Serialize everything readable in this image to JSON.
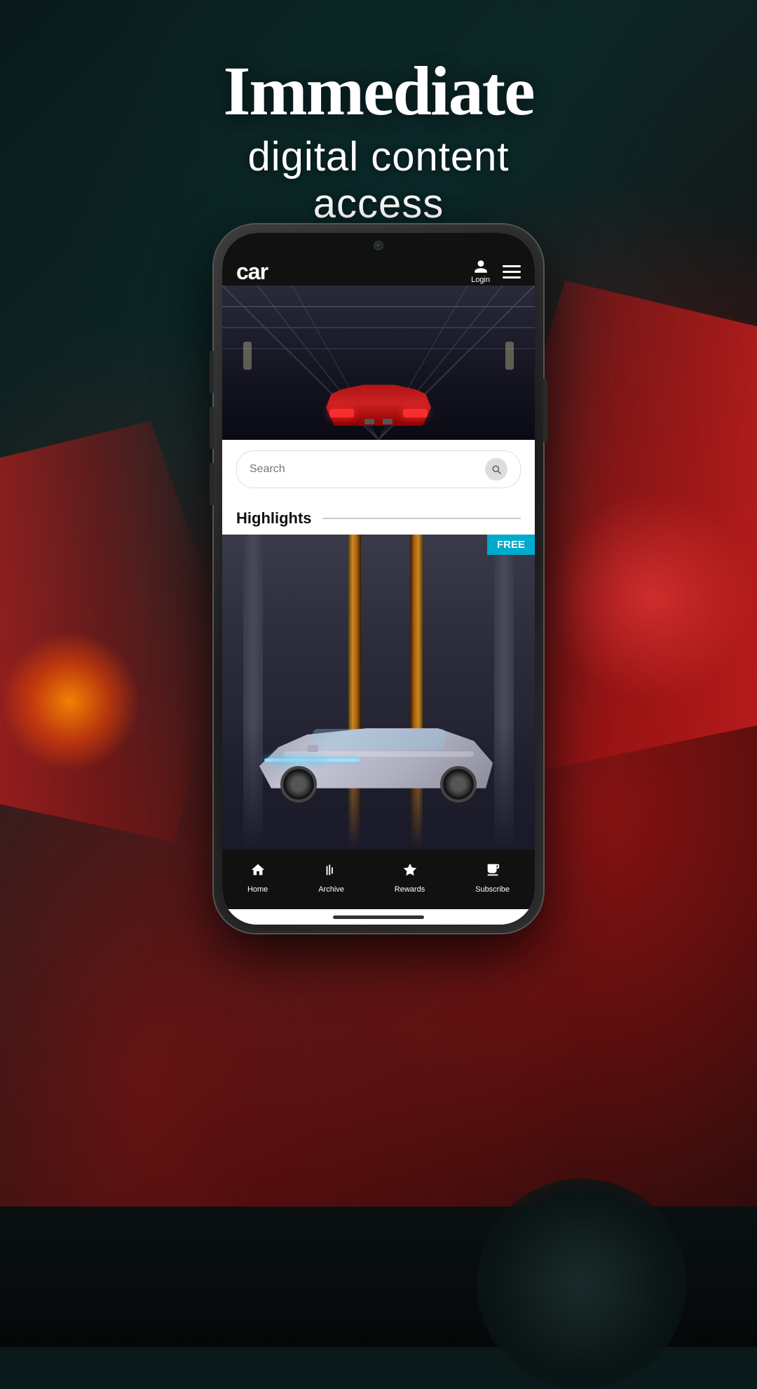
{
  "background": {
    "color": "#0a1a1a"
  },
  "header": {
    "line1": "Immediate",
    "line2": "digital content",
    "line3": "access"
  },
  "phone": {
    "app": {
      "brand_logo": "car",
      "nav_login": "Login",
      "nav_menu_label": "menu"
    },
    "search": {
      "placeholder": "Search",
      "icon": "search-icon"
    },
    "highlights": {
      "title": "Highlights",
      "line": true
    },
    "card": {
      "badge": "FREE"
    },
    "bottom_nav": {
      "items": [
        {
          "icon": "🏠",
          "label": "Home",
          "name": "home"
        },
        {
          "icon": "|||",
          "label": "Archive",
          "name": "archive"
        },
        {
          "icon": "★",
          "label": "Rewards",
          "name": "rewards"
        },
        {
          "icon": "📋",
          "label": "Subscribe",
          "name": "subscribe"
        }
      ]
    }
  }
}
